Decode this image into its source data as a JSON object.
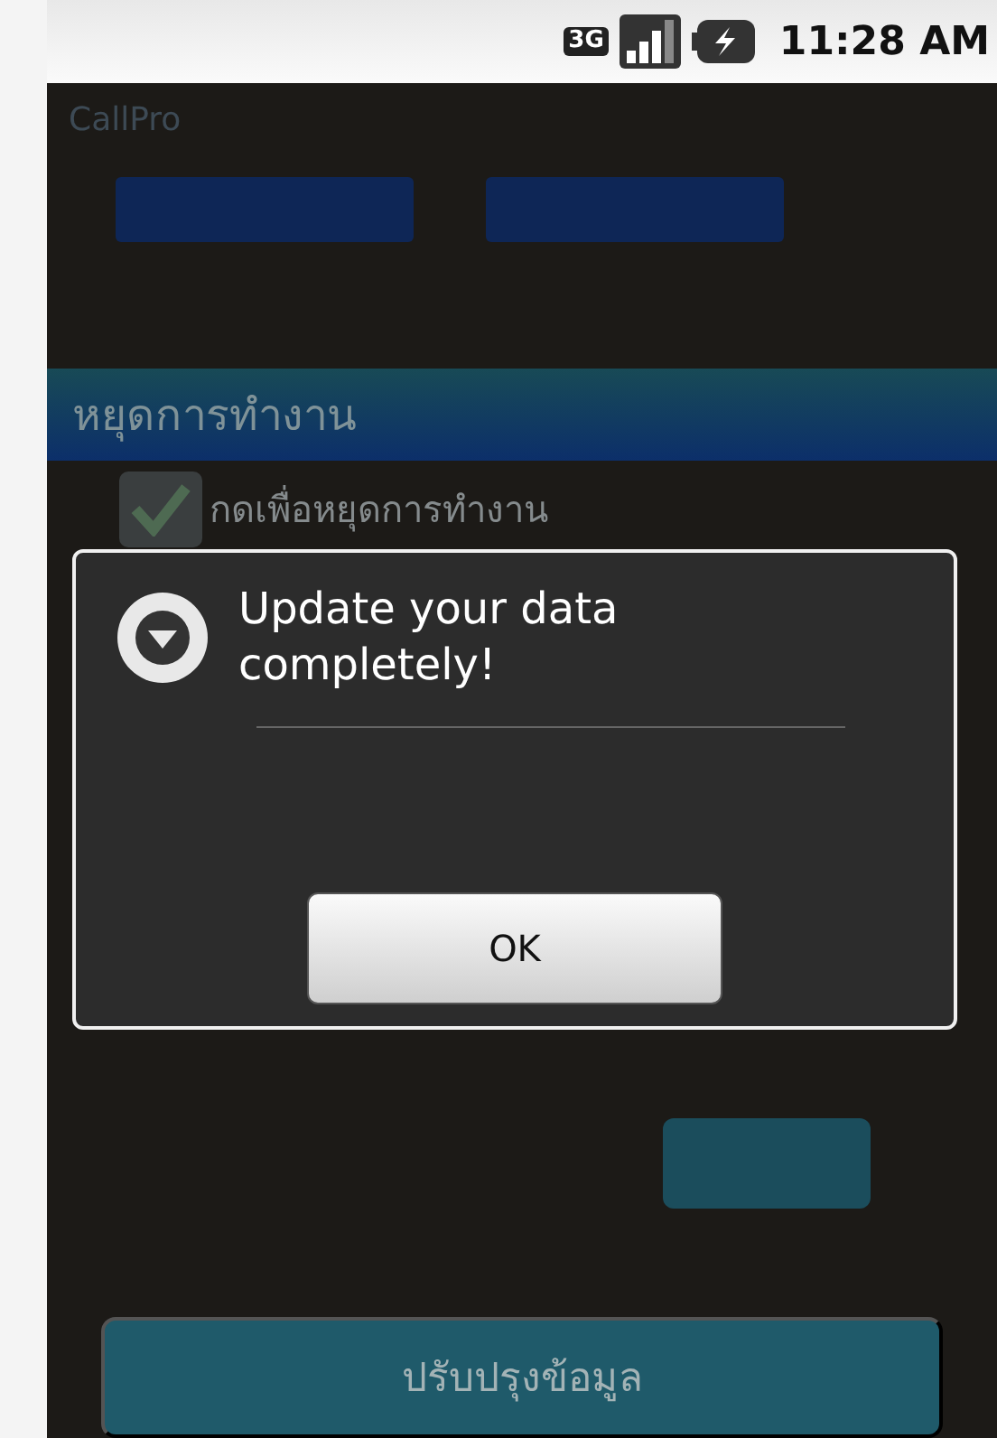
{
  "status_bar": {
    "time": "11:28 AM",
    "network": "3G"
  },
  "app": {
    "title": "CallPro",
    "section_header": "หยุดการทำงาน",
    "checkbox": {
      "label": "กดเพื่อหยุดการทำงาน",
      "checked": true
    },
    "bottom_button": "ปรับปรุงข้อมูล"
  },
  "dialog": {
    "message": "Update your data completely!",
    "buttons": [
      "OK"
    ]
  }
}
